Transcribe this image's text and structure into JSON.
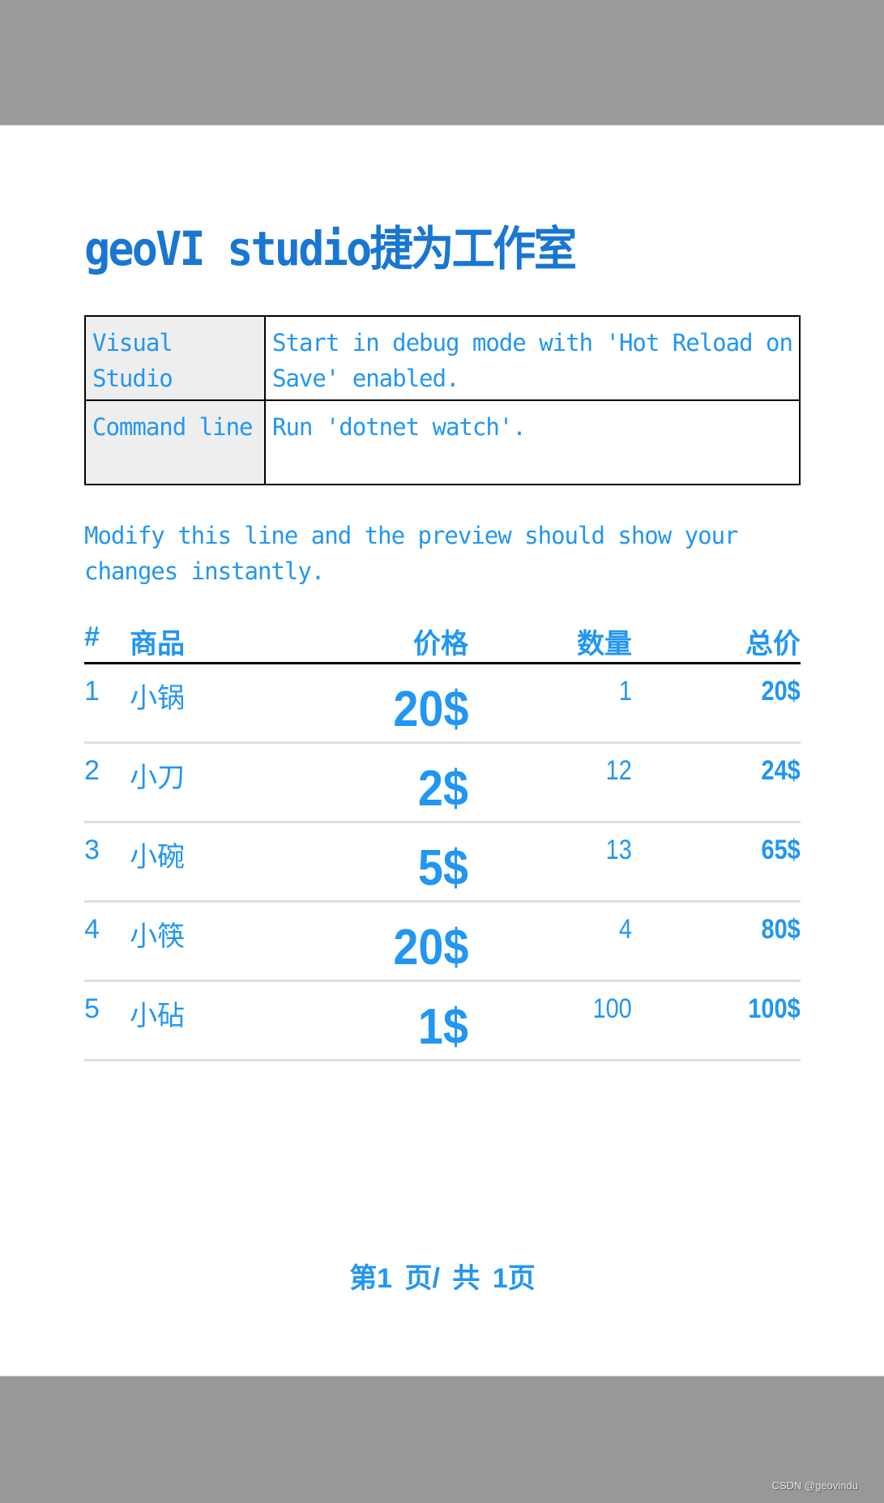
{
  "document": {
    "title": "geoVI studio捷为工作室",
    "info_table": [
      {
        "label": "Visual Studio",
        "value": "Start in debug mode with 'Hot Reload on Save' enabled."
      },
      {
        "label": "Command line",
        "value": "Run 'dotnet watch'."
      }
    ],
    "note": "Modify this line and the preview should show your changes instantly.",
    "items_table": {
      "headers": {
        "index": "#",
        "product": "商品",
        "price": "价格",
        "quantity": "数量",
        "total": "总价"
      },
      "rows": [
        {
          "index": "1",
          "product": "小锅",
          "price": "20$",
          "quantity": "1",
          "total": "20$"
        },
        {
          "index": "2",
          "product": "小刀",
          "price": "2$",
          "quantity": "12",
          "total": "24$"
        },
        {
          "index": "3",
          "product": "小碗",
          "price": "5$",
          "quantity": "13",
          "total": "65$"
        },
        {
          "index": "4",
          "product": "小筷",
          "price": "20$",
          "quantity": "4",
          "total": "80$"
        },
        {
          "index": "5",
          "product": "小砧",
          "price": "1$",
          "quantity": "100",
          "total": "100$"
        }
      ]
    },
    "footer": "第1 页/ 共 1页"
  },
  "watermark": "CSDN @geovindu",
  "colors": {
    "text_primary": "#2196f3",
    "title": "#1976d2",
    "background_band": "#9a9a9a"
  }
}
